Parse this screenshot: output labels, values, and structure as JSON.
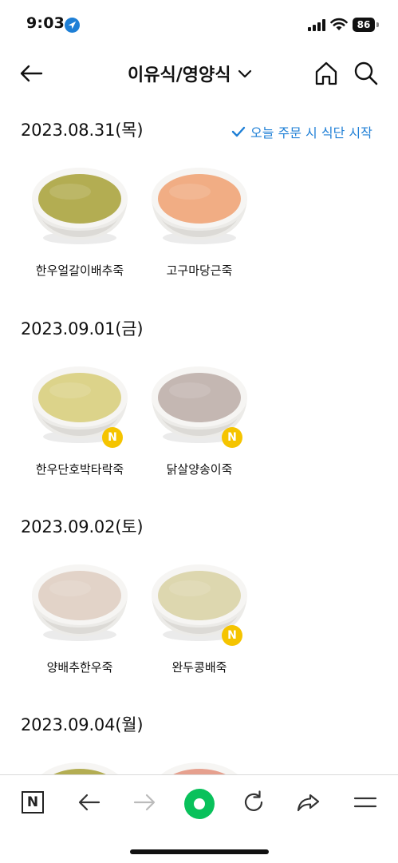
{
  "status": {
    "time": "9:03",
    "battery": "86"
  },
  "header": {
    "title": "이유식/영양식"
  },
  "start_link": "오늘 주문 시 식단 시작",
  "badge_letter": "N",
  "days": [
    {
      "date": "2023.08.31(목)",
      "items": [
        {
          "name": "한우얼갈이배추죽",
          "soup_color": "#b3ad52",
          "badge": false
        },
        {
          "name": "고구마당근죽",
          "soup_color": "#f1ad84",
          "badge": false
        }
      ]
    },
    {
      "date": "2023.09.01(금)",
      "items": [
        {
          "name": "한우단호박타락죽",
          "soup_color": "#dcd38a",
          "badge": true
        },
        {
          "name": "닭살양송이죽",
          "soup_color": "#c4b7b2",
          "badge": true
        }
      ]
    },
    {
      "date": "2023.09.02(토)",
      "items": [
        {
          "name": "양배추한우죽",
          "soup_color": "#e2d3c8",
          "badge": false
        },
        {
          "name": "완두콩배죽",
          "soup_color": "#ddd7af",
          "badge": true
        }
      ]
    },
    {
      "date": "2023.09.04(월)",
      "items": [
        {
          "name": "",
          "soup_color": "#b3ad52",
          "badge": false
        },
        {
          "name": "",
          "soup_color": "#e6a08e",
          "badge": false
        }
      ]
    }
  ],
  "colors": {
    "accent": "#1e7fd6",
    "badge": "#f5c400",
    "naver_green": "#09c15b"
  },
  "icons": [
    "location-arrow-icon",
    "signal-icon",
    "wifi-icon",
    "battery-icon",
    "back-arrow-icon",
    "chevron-down-icon",
    "home-icon",
    "search-icon",
    "check-icon",
    "naver-n-icon",
    "browser-back-icon",
    "browser-forward-icon",
    "naver-green-icon",
    "refresh-icon",
    "share-icon",
    "menu-icon"
  ]
}
